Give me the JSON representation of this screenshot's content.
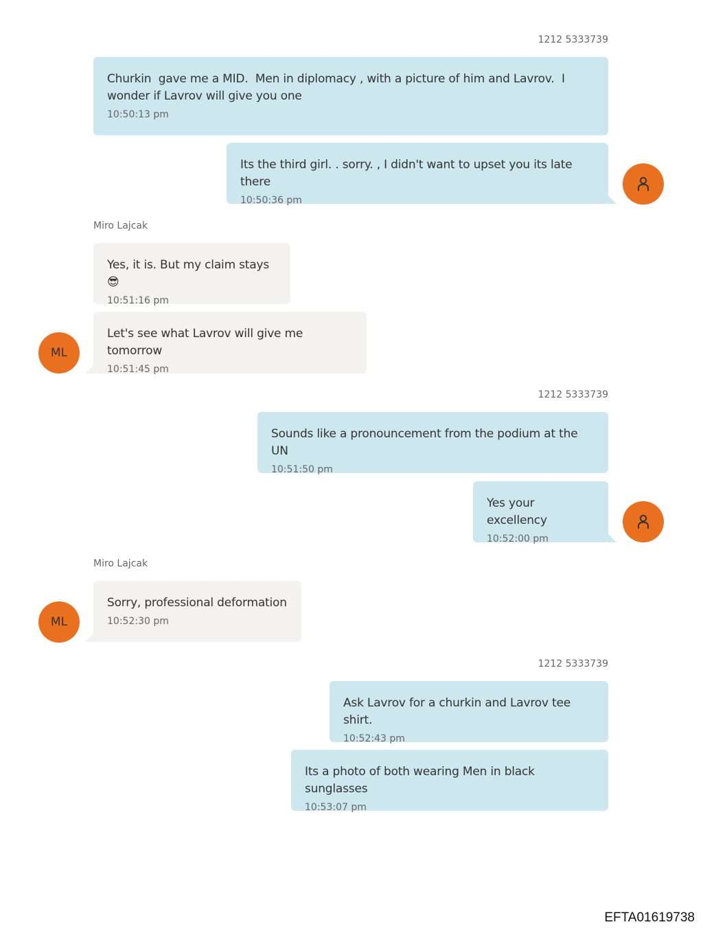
{
  "messages": [
    {
      "text": "Churkin  gave me a MID.  Men in diplomacy , with a picture of him and Lavrov.  I wonder if Lavrov will give you one",
      "time": "10:50:13 pm"
    },
    {
      "text": "Its the third girl. . sorry. , I didn't want to upset you its late there",
      "time": "10:50:36 pm"
    },
    {
      "text": "Yes, it is. But my claim stays😎",
      "time": "10:51:16 pm"
    },
    {
      "text": "Let's see what Lavrov will give me tomorrow",
      "time": "10:51:45 pm"
    },
    {
      "text": "Sounds like a pronouncement from the podium at the UN",
      "time": "10:51:50 pm"
    },
    {
      "text": "Yes your excellency",
      "time": "10:52:00 pm"
    },
    {
      "text": "Sorry, professional deformation",
      "time": "10:52:30 pm"
    },
    {
      "text": "Ask Lavrov for a churkin and Lavrov tee shirt.",
      "time": "10:52:43 pm"
    },
    {
      "text": "Its a photo of both wearing Men in black sunglasses",
      "time": "10:53:07 pm"
    }
  ],
  "labels": {
    "outgoing_sender": "1212 5333739",
    "incoming_sender": "Miro Lajcak",
    "incoming_avatar_initials": "ML"
  },
  "icons": {
    "outgoing_avatar": "person-icon"
  },
  "colors": {
    "outgoing_bubble": "#cce8ee",
    "incoming_bubble": "#f3f2ef",
    "avatar": "#e8701e"
  },
  "footer": {
    "document_id": "EFTA01619738"
  }
}
